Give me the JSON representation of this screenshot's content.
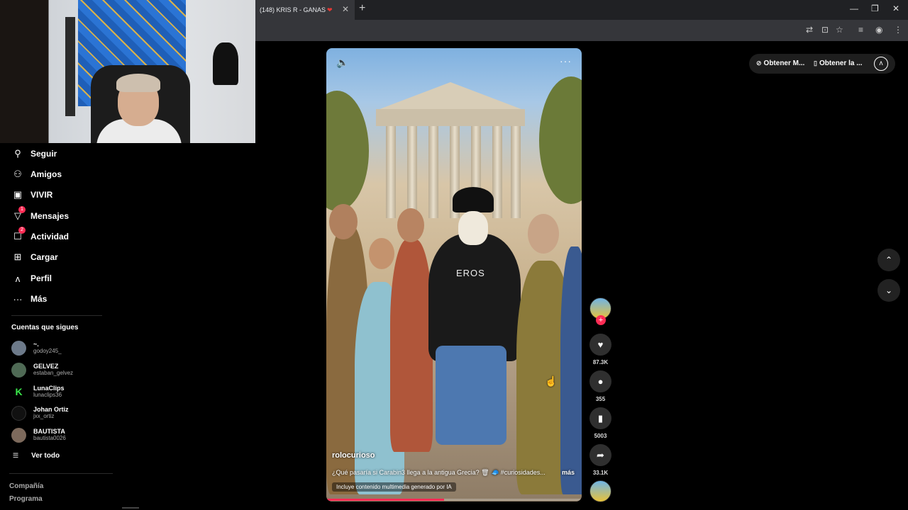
{
  "browser": {
    "tab_title": "(148) KRIS R - GANAS",
    "tab_heart": "❤",
    "tab_close": "✕",
    "new_tab": "+",
    "minimize": "—",
    "restore": "❐",
    "close": "✕"
  },
  "sidebar": {
    "items": [
      {
        "label": "Seguir",
        "icon": "user-follow-icon",
        "glyph": "⛹"
      },
      {
        "label": "Amigos",
        "icon": "friends-icon",
        "glyph": "👥"
      },
      {
        "label": "VIVIR",
        "icon": "live-icon",
        "glyph": "📺"
      },
      {
        "label": "Mensajes",
        "icon": "messages-icon",
        "glyph": "✈",
        "badge": "1"
      },
      {
        "label": "Actividad",
        "icon": "activity-icon",
        "glyph": "💬",
        "badge": "2"
      },
      {
        "label": "Cargar",
        "icon": "upload-icon",
        "glyph": "⊞"
      },
      {
        "label": "Perfil",
        "icon": "profile-icon",
        "glyph": "ʌ"
      },
      {
        "label": "Más",
        "icon": "more-icon",
        "glyph": "···"
      }
    ],
    "following_title": "Cuentas que sigues",
    "following": [
      {
        "name": "~.",
        "handle": "godoy245_"
      },
      {
        "name": "GELVEZ",
        "handle": "estaban_gelvez"
      },
      {
        "name": "LunaClips",
        "handle": "lunaclips36"
      },
      {
        "name": "Johan Ortiz",
        "handle": "jxx_ortiz"
      },
      {
        "name": "BAUTISTA",
        "handle": "bautista0026"
      }
    ],
    "see_all": "Ver todo",
    "footer": [
      "Compañía",
      "Programa"
    ]
  },
  "video": {
    "author": "rolocurioso",
    "description": "¿Qué pasaría si Carabin3 llega a la antigua Grecia? 🗑 🧢 #curiosidades...",
    "more": "más",
    "ai_label": "Incluye contenido multimedia generado por IA",
    "shirt_text": "EROS",
    "progress": 0.46,
    "sound_icon": "🔈",
    "more_icon": "···"
  },
  "actions": {
    "likes": "87.3K",
    "comments": "355",
    "saves": "5003",
    "shares": "33.1K",
    "follow_plus": "+"
  },
  "topright": {
    "get_app": "Obtener M...",
    "get_app_icon": "⊘",
    "get_desktop": "Obtener la ...",
    "get_desktop_icon": "▯",
    "profile_glyph": "ʌ"
  },
  "navigation": {
    "up": "⌃",
    "down": "⌄"
  }
}
